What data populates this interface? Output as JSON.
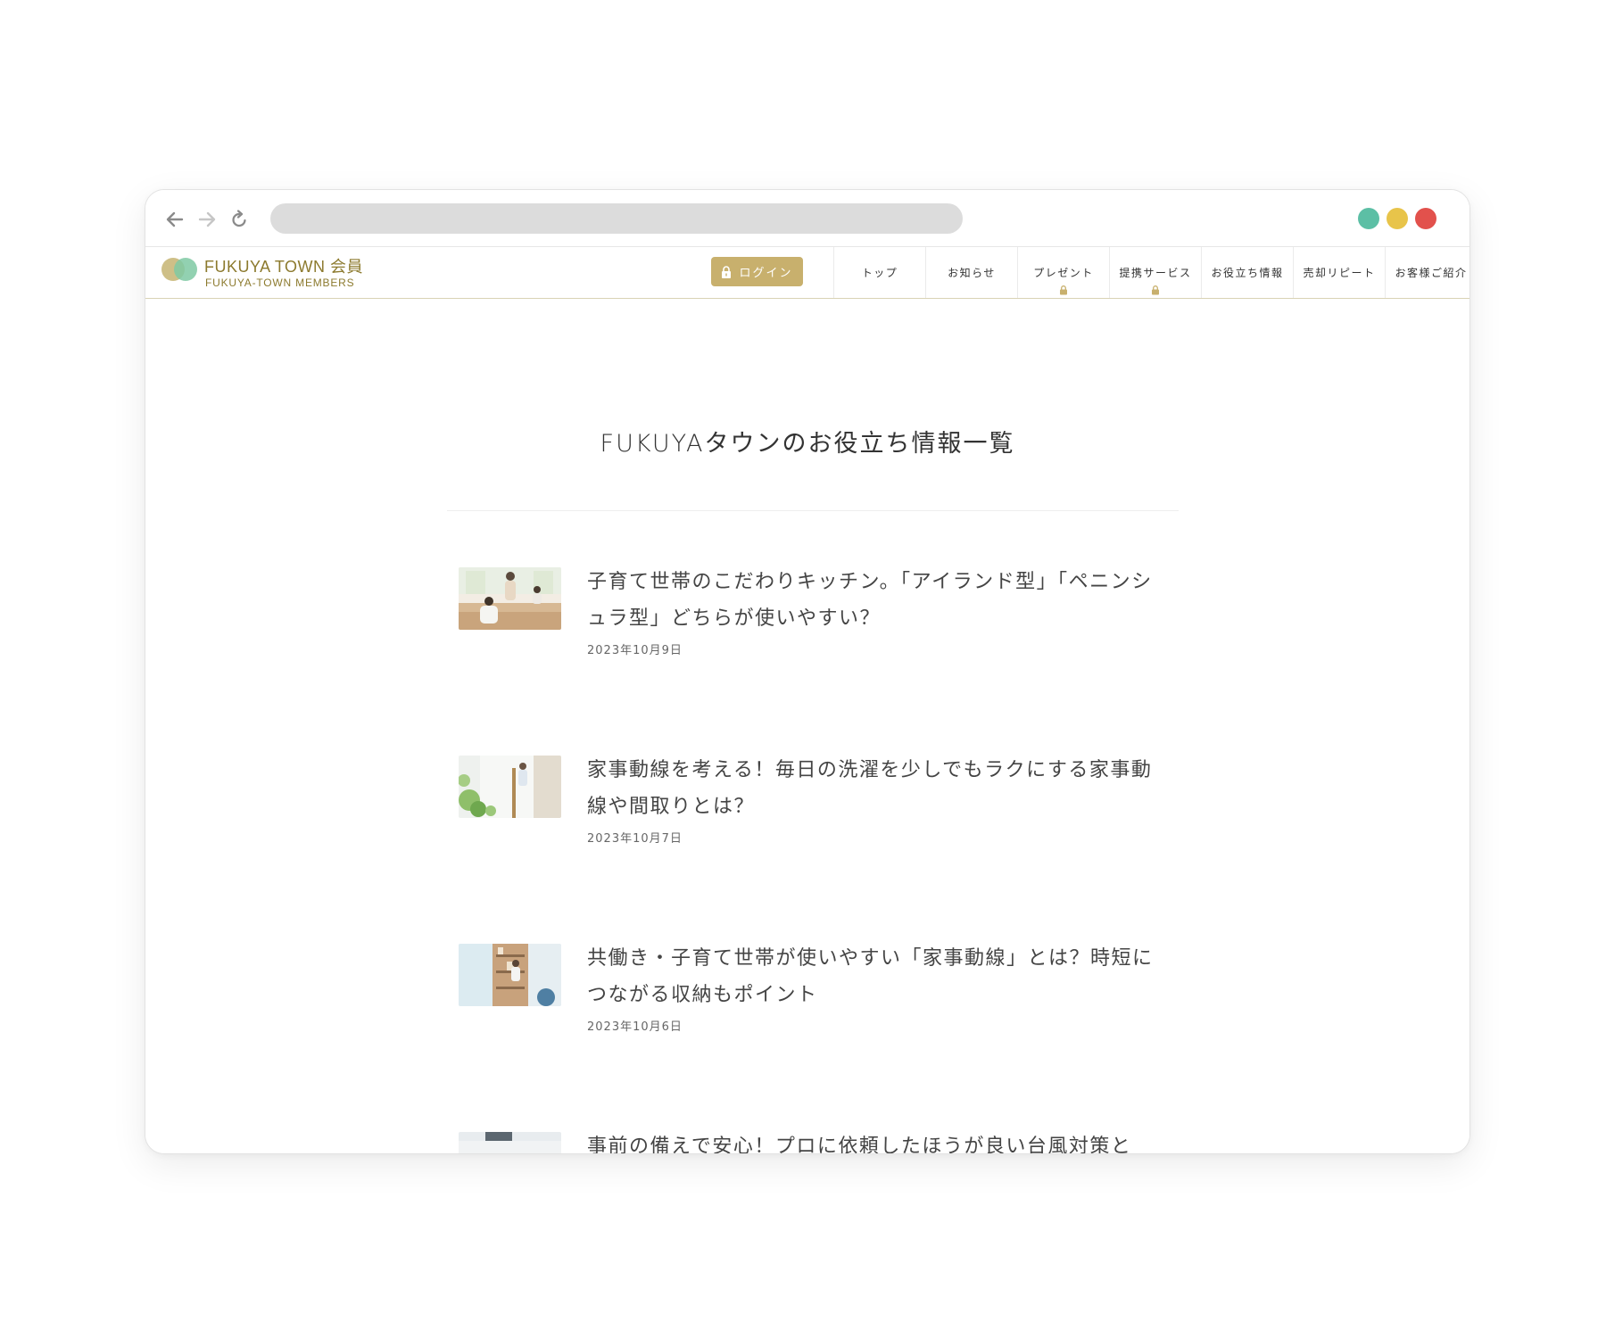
{
  "site": {
    "logo_title": "FUKUYA TOWN 会員",
    "logo_sub": "FUKUYA-TOWN MEMBERS",
    "login_label": "ログイン",
    "menu": [
      {
        "label": "トップ",
        "locked": false
      },
      {
        "label": "お知らせ",
        "locked": false
      },
      {
        "label": "プレゼント",
        "locked": true
      },
      {
        "label": "提携サービス",
        "locked": true
      },
      {
        "label": "お役立ち情報",
        "locked": false
      },
      {
        "label": "売却リピート",
        "locked": false
      },
      {
        "label": "お客様ご紹介",
        "locked": false
      }
    ]
  },
  "page": {
    "title": "FUKUYAタウンのお役立ち情報一覧"
  },
  "articles": [
    {
      "title": "子育て世帯のこだわりキッチン。「アイランド型」「ペニンシュラ型」どちらが使いやすい？",
      "date": "2023年10月9日",
      "thumb": "kitchen-family-photo"
    },
    {
      "title": "家事動線を考える！毎日の洗濯を少しでもラクにする家事動線や間取りとは？",
      "date": "2023年10月7日",
      "thumb": "laundry-room-photo"
    },
    {
      "title": "共働き・子育て世帯が使いやすい「家事動線」とは？時短につながる収納もポイント",
      "date": "2023年10月6日",
      "thumb": "storage-shelf-photo"
    },
    {
      "title": "事前の備えで安心！プロに依頼したほうが良い台風対策と",
      "date": "",
      "thumb": "window-photo"
    }
  ],
  "colors": {
    "brand_gold": "#8c7a2e",
    "login_bg": "#c8b06d",
    "traffic_green": "#5cbfa5",
    "traffic_yellow": "#e8c44a",
    "traffic_red": "#e2514c"
  }
}
